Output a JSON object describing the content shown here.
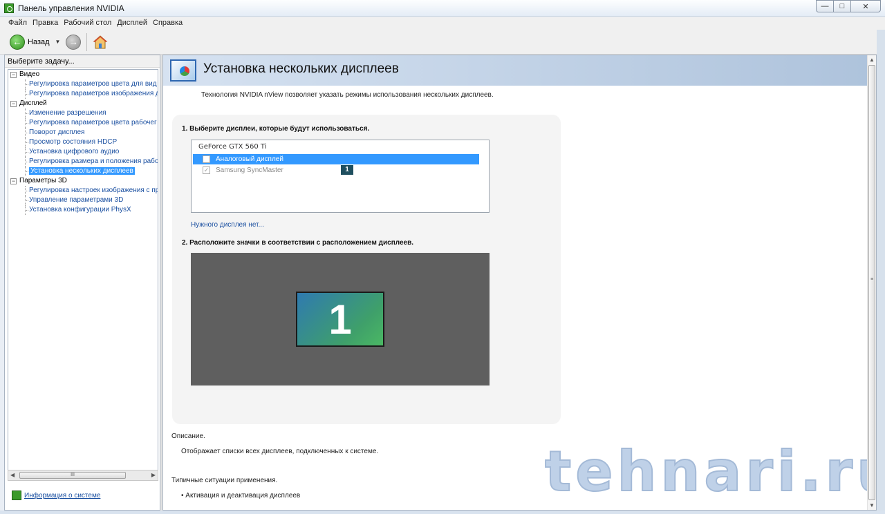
{
  "window": {
    "title": "Панель управления NVIDIA",
    "controls": {
      "minimize": "—",
      "maximize": "□",
      "close": "✕"
    }
  },
  "menu": [
    "Файл",
    "Правка",
    "Рабочий стол",
    "Дисплей",
    "Справка"
  ],
  "toolbar": {
    "back_label": "Назад",
    "icons": [
      "back-icon",
      "dropdown-icon",
      "forward-icon",
      "home-icon"
    ]
  },
  "sidebar": {
    "header": "Выберите задачу...",
    "categories": [
      {
        "label": "Видео",
        "items": [
          "Регулировка параметров цвета для вид",
          "Регулировка параметров изображения д"
        ]
      },
      {
        "label": "Дисплей",
        "items": [
          "Изменение разрешения",
          "Регулировка параметров цвета рабочег",
          "Поворот дисплея",
          "Просмотр состояния HDCP",
          "Установка цифрового аудио",
          "Регулировка размера и положения рабо",
          "Установка нескольких дисплеев"
        ]
      },
      {
        "label": "Параметры 3D",
        "items": [
          "Регулировка настроек изображения с пр",
          "Управление параметрами 3D",
          "Установка конфигурации PhysX"
        ]
      }
    ],
    "selected_item": "Установка нескольких дисплеев",
    "scroll_grip": "III",
    "sysinfo_link": "Информация о системе"
  },
  "main": {
    "title": "Установка нескольких дисплеев",
    "intro": "Технология NVIDIA nView позволяет указать режимы использования нескольких дисплеев.",
    "step1": "1. Выберите дисплеи, которые будут использоваться.",
    "gpu": "GeForce GTX 560 Ti",
    "displays": [
      {
        "name": "Аналоговый дисплей",
        "checked": false,
        "highlighted": true
      },
      {
        "name": "Samsung SyncMaster",
        "checked": true,
        "highlighted": false,
        "badge": "1"
      }
    ],
    "missing_link": "Нужного дисплея нет...",
    "step2": "2. Расположите значки в соответствии с расположением дисплеев.",
    "monitor_number": "1",
    "description_label": "Описание.",
    "description_text": "Отображает списки всех дисплеев, подключенных к системе.",
    "usage_label": "Типичные ситуации применения.",
    "usage_items": [
      "• Активация и деактивация дисплеев"
    ]
  },
  "watermark": "tehnari.ru",
  "colors": {
    "selection": "#3399ff",
    "link": "#1a4fa0",
    "header_gradient_end": "#aec3dc",
    "arrange_bg": "#5f5f5f"
  }
}
